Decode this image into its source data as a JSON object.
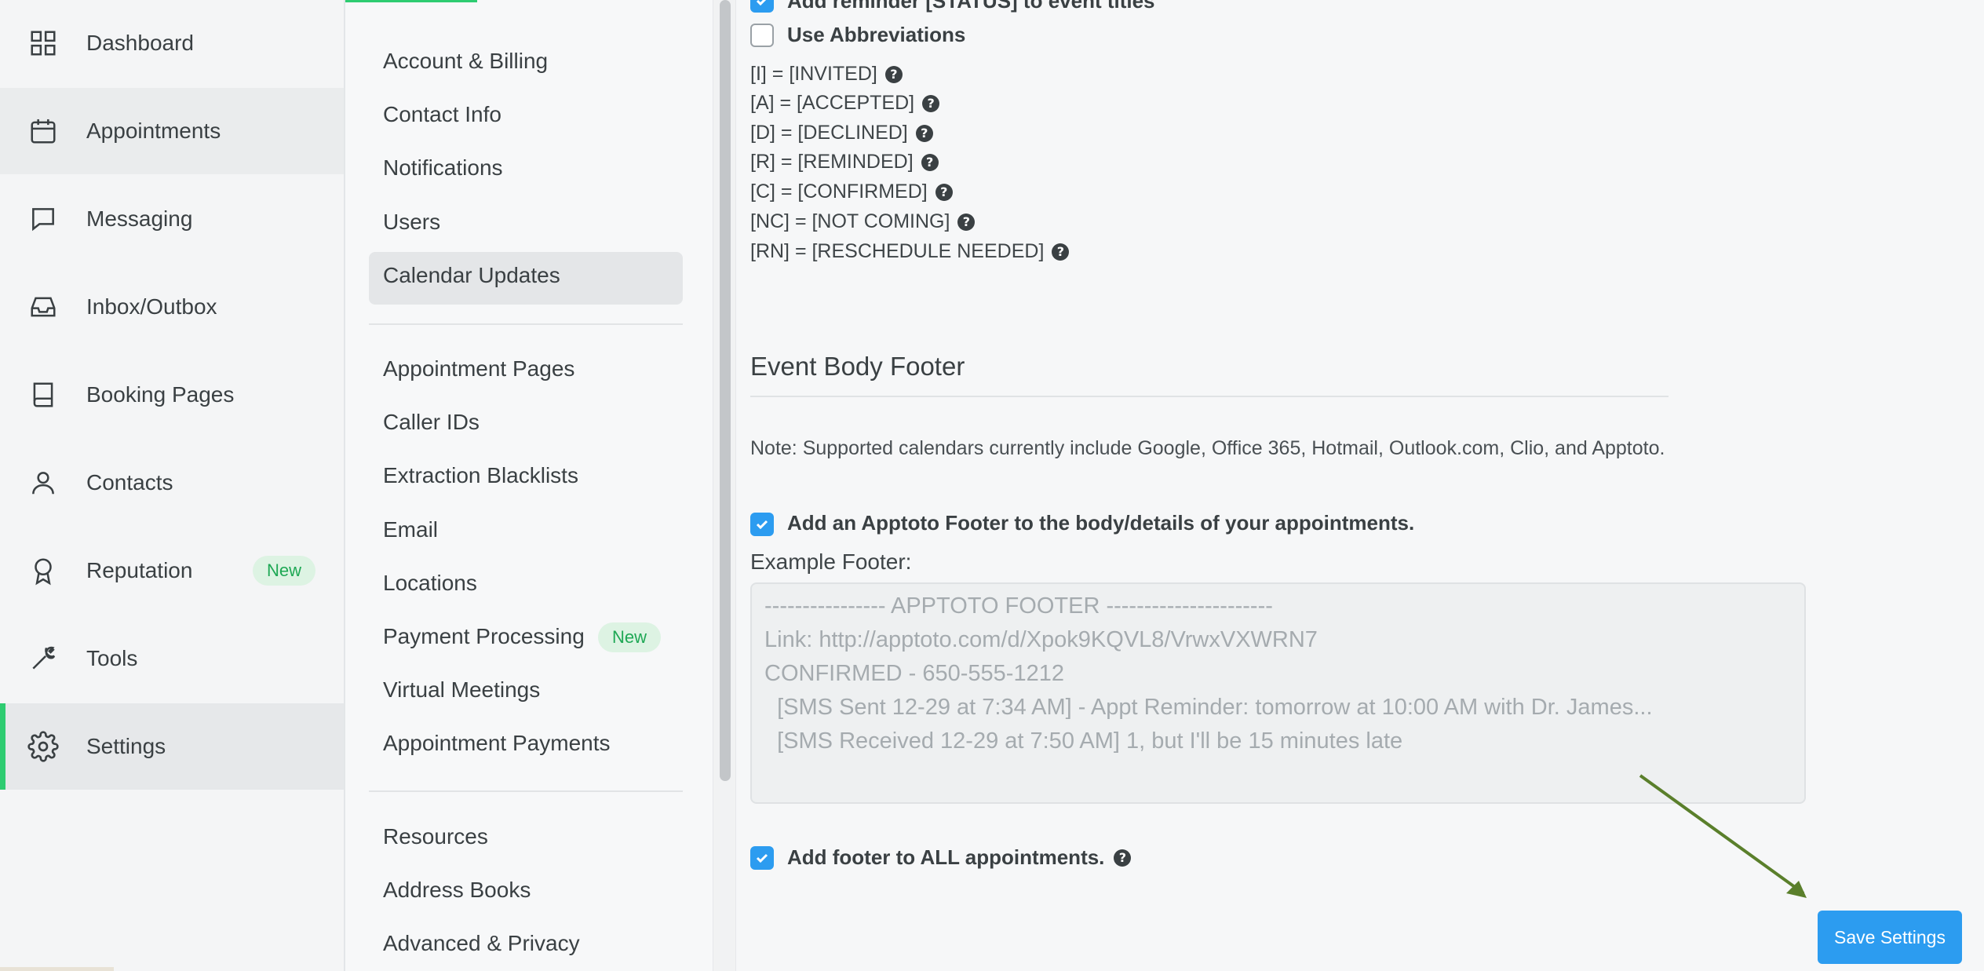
{
  "nav": {
    "items": [
      {
        "label": "Dashboard",
        "icon": "dashboard-grid-icon"
      },
      {
        "label": "Appointments",
        "icon": "calendar-icon"
      },
      {
        "label": "Messaging",
        "icon": "message-icon"
      },
      {
        "label": "Inbox/Outbox",
        "icon": "inbox-icon"
      },
      {
        "label": "Booking Pages",
        "icon": "book-icon"
      },
      {
        "label": "Contacts",
        "icon": "person-icon"
      },
      {
        "label": "Reputation",
        "icon": "award-icon",
        "badge": "New"
      },
      {
        "label": "Tools",
        "icon": "wrench-icon"
      },
      {
        "label": "Settings",
        "icon": "gear-icon"
      }
    ]
  },
  "settings_menu": {
    "group1": [
      "Account & Billing",
      "Contact Info",
      "Notifications",
      "Users",
      "Calendar Updates"
    ],
    "group2": [
      "Appointment Pages",
      "Caller IDs",
      "Extraction Blacklists",
      "Email",
      "Locations",
      "Payment Processing",
      "Virtual Meetings",
      "Appointment Payments"
    ],
    "payment_badge": "New",
    "group3": [
      "Resources",
      "Address Books",
      "Advanced & Privacy"
    ]
  },
  "content": {
    "add_reminder_label": "Add reminder [STATUS] to event titles",
    "use_abbreviations_label": "Use Abbreviations",
    "abbreviations": [
      "[I] = [INVITED]",
      "[A] = [ACCEPTED]",
      "[D] = [DECLINED]",
      "[R] = [REMINDED]",
      "[C] = [CONFIRMED]",
      "[NC] = [NOT COMING]",
      "[RN] = [RESCHEDULE NEEDED]"
    ],
    "section_title": "Event Body Footer",
    "note": "Note: Supported calendars currently include Google, Office 365, Hotmail, Outlook.com, Clio, and Apptoto.",
    "add_footer_label": "Add an Apptoto Footer to the body/details of your appointments.",
    "example_label": "Example Footer:",
    "example_lines": [
      "---------------- APPTOTO FOOTER ----------------------",
      "Link: http://apptoto.com/d/Xpok9KQVL8/VrwxVXWRN7",
      "CONFIRMED - 650-555-1212",
      "  [SMS Sent 12-29 at 7:34 AM] - Appt Reminder: tomorrow at 10:00 AM with Dr. James...",
      "  [SMS Received 12-29 at 7:50 AM] 1, but I'll be 15 minutes late"
    ],
    "all_appointments_label": "Add footer to ALL appointments.",
    "save_button": "Save Settings"
  },
  "colors": {
    "accent_green": "#2ecc71",
    "checkbox_blue": "#2c9cf0",
    "arrow_green": "#5a7f2b"
  }
}
